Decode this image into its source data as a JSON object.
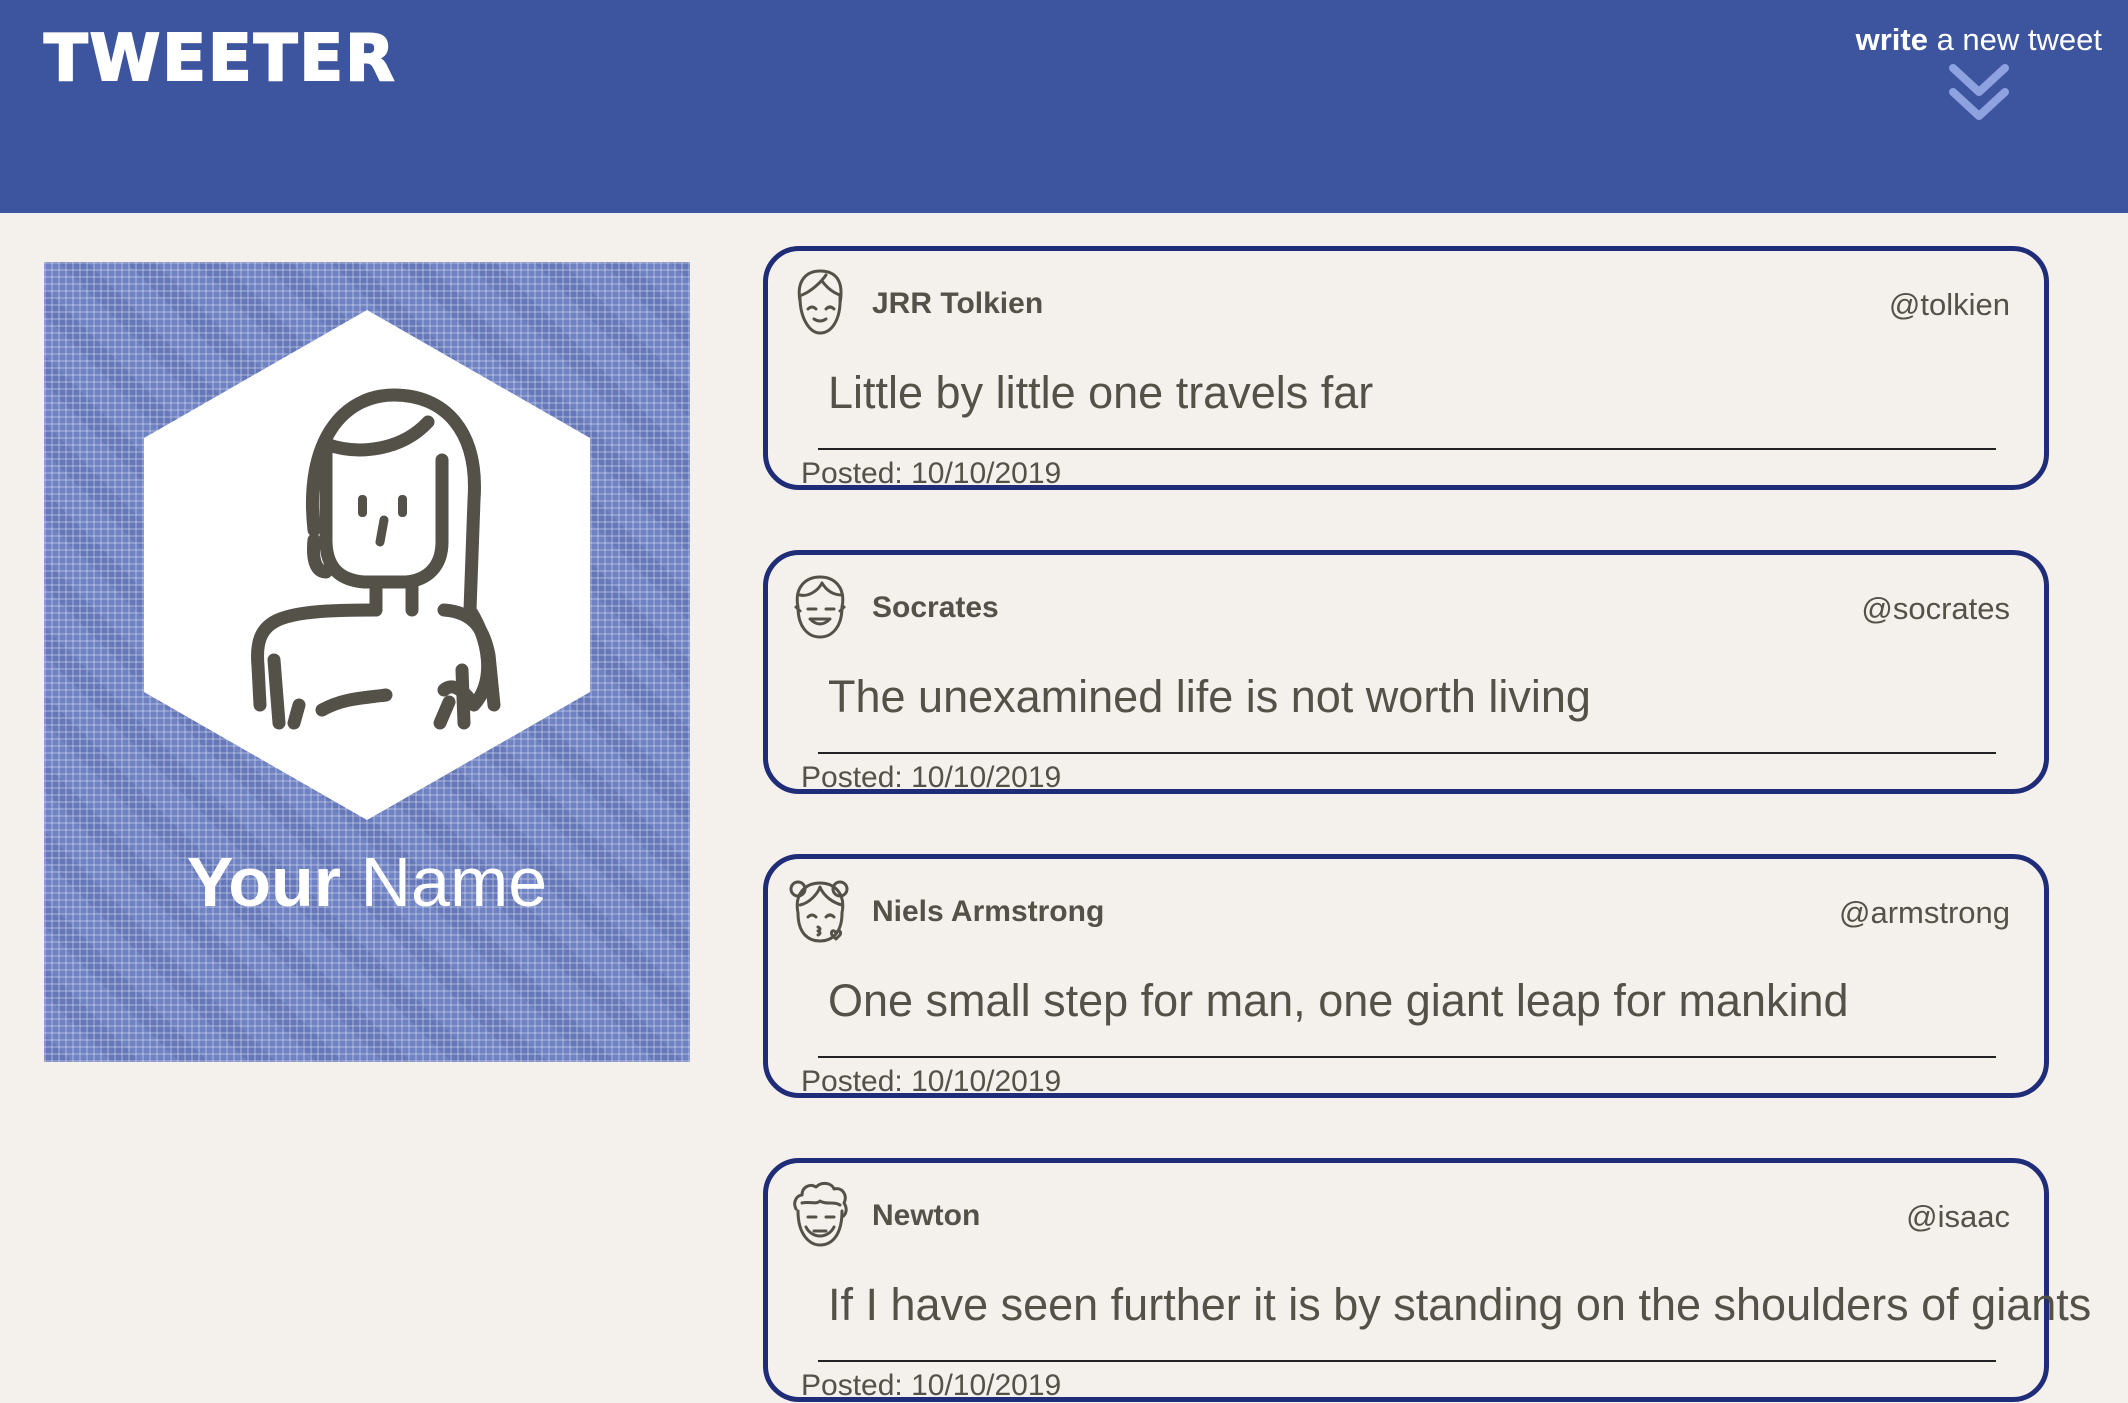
{
  "header": {
    "brand": "TWEETER",
    "compose_bold": "write",
    "compose_rest": " a new tweet",
    "compose_icon": "double-chevron-down-icon"
  },
  "profile": {
    "first_name": "Your",
    "last_name": "Name",
    "avatar_icon": "girl-avatar-icon"
  },
  "tweets": [
    {
      "name": "JRR Tolkien",
      "handle": "@tolkien",
      "text": "Little by little one travels far",
      "posted": "Posted: 10/10/2019",
      "avatar": "smiling-face-avatar-icon"
    },
    {
      "name": "Socrates",
      "handle": "@socrates",
      "text": "The unexamined life is not worth living",
      "posted": "Posted: 10/10/2019",
      "avatar": "grinning-face-avatar-icon"
    },
    {
      "name": "Niels Armstrong",
      "handle": "@armstrong",
      "text": "One small step for man, one giant leap for mankind",
      "posted": "Posted: 10/10/2019",
      "avatar": "girl-kiss-avatar-icon"
    },
    {
      "name": "Newton",
      "handle": "@isaac",
      "text": "If I have seen further it is by standing on the shoulders of giants",
      "posted": "Posted: 10/10/2019",
      "avatar": "curly-hair-avatar-icon"
    }
  ],
  "colors": {
    "header_bg": "#3d549e",
    "page_bg": "#f4f1ed",
    "tweet_border": "#1f2d78",
    "profile_bg": "#6f82c3",
    "text": "#545149"
  }
}
